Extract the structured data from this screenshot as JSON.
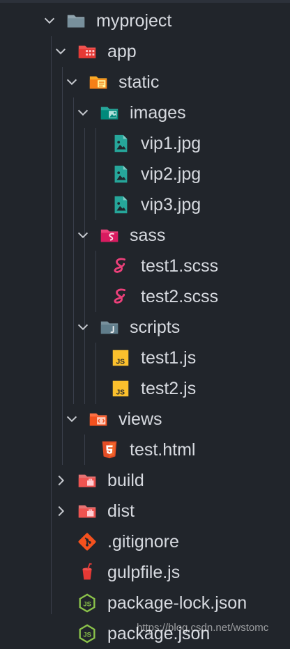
{
  "explorer": {
    "items": [
      {
        "label": "myproject",
        "icon": "folder-icon"
      },
      {
        "label": "app",
        "icon": "app-folder-icon"
      },
      {
        "label": "static",
        "icon": "static-folder-icon"
      },
      {
        "label": "images",
        "icon": "images-folder-icon"
      },
      {
        "label": "vip1.jpg",
        "icon": "image-file-icon"
      },
      {
        "label": "vip2.jpg",
        "icon": "image-file-icon"
      },
      {
        "label": "vip3.jpg",
        "icon": "image-file-icon"
      },
      {
        "label": "sass",
        "icon": "sass-folder-icon"
      },
      {
        "label": "test1.scss",
        "icon": "sass-file-icon"
      },
      {
        "label": "test2.scss",
        "icon": "sass-file-icon"
      },
      {
        "label": "scripts",
        "icon": "scripts-folder-icon"
      },
      {
        "label": "test1.js",
        "icon": "js-file-icon"
      },
      {
        "label": "test2.js",
        "icon": "js-file-icon"
      },
      {
        "label": "views",
        "icon": "views-folder-icon"
      },
      {
        "label": "test.html",
        "icon": "html-file-icon"
      },
      {
        "label": "build",
        "icon": "build-folder-icon"
      },
      {
        "label": "dist",
        "icon": "dist-folder-icon"
      },
      {
        "label": ".gitignore",
        "icon": "git-icon"
      },
      {
        "label": "gulpfile.js",
        "icon": "gulp-icon"
      },
      {
        "label": "package-lock.json",
        "icon": "nodejs-icon"
      },
      {
        "label": "package.json",
        "icon": "nodejs-icon"
      }
    ]
  },
  "watermark": "https://blog.csdn.net/wstomc",
  "colors": {
    "background": "#21252b",
    "text": "#d7dae0",
    "folder_grey": "#90a4ae",
    "app_red": "#ef5350",
    "static_yellow": "#f9a825",
    "images_teal": "#26a69a",
    "sass_pink": "#ec407a",
    "js_yellow": "#fbc02d",
    "views_orange": "#ff7043",
    "html_orange": "#e44d26",
    "build_pink": "#e57373",
    "git_orange": "#f4511e",
    "gulp_red": "#e53935",
    "node_green": "#8bc34a"
  }
}
